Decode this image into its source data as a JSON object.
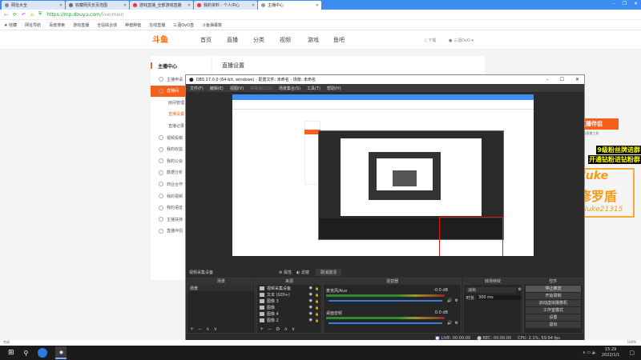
{
  "browser": {
    "tabs": [
      {
        "label": "网址大全",
        "active": false
      },
      {
        "label": "收藏网页长页范围",
        "active": false
      },
      {
        "label": "游戏直播_全部游戏直播",
        "active": false
      },
      {
        "label": "我的资料 - 个人中心",
        "active": false
      },
      {
        "label": "主播中心",
        "active": true
      }
    ],
    "url_host": "https://mp.douyu.com",
    "url_path": "/live/main",
    "bookmarks": [
      "收藏",
      "网址导航",
      "百度搜索",
      "游戏直播",
      "全站综合体",
      "种植种植",
      "在线直播",
      "三酒OvO直",
      "斗鱼弹幕数"
    ],
    "status_left": "完成",
    "status_right": "100%"
  },
  "douyu": {
    "logo": "斗鱼",
    "nav": [
      "首页",
      "直播",
      "分类",
      "视频",
      "游戏",
      "鱼吧"
    ],
    "download": "下载",
    "user": "三酒OvO",
    "sidebar_title": "主播中心",
    "sidebar": [
      {
        "label": "主播申请",
        "type": "item"
      },
      {
        "label": "直播间",
        "type": "active"
      },
      {
        "label": "房间管理",
        "type": "sub"
      },
      {
        "label": "直播设置",
        "type": "sub-orange"
      },
      {
        "label": "直播记录",
        "type": "sub"
      },
      {
        "label": "视频投稿",
        "type": "item"
      },
      {
        "label": "我的收益",
        "type": "item"
      },
      {
        "label": "我的公会",
        "type": "item"
      },
      {
        "label": "数据分析",
        "type": "item"
      },
      {
        "label": "商业合作",
        "type": "item"
      },
      {
        "label": "我的视频",
        "type": "item"
      },
      {
        "label": "我的语音",
        "type": "item"
      },
      {
        "label": "主播扶持",
        "type": "item"
      },
      {
        "label": "直播伴侣",
        "type": "item"
      }
    ],
    "content_title": "直播设置"
  },
  "obs": {
    "title": "OBS 27.0.0 (64-bit, windows) - 配置文件: 未命名 - 场景: 未命名",
    "menu": [
      "文件(F)",
      "编辑(E)",
      "视图(V)",
      "停靠窗口(D)",
      "场景集合(S)",
      "工具(T)",
      "帮助(H)"
    ],
    "source_bar": {
      "selected": "视频采集设备",
      "properties": "属性",
      "filters": "滤镜",
      "deactivate": "取消激活"
    },
    "scenes": {
      "header": "场景",
      "items": [
        "场景"
      ]
    },
    "sources": {
      "header": "来源",
      "items": [
        "视频采集设备",
        "文本 (GDI+)",
        "图像 3",
        "图像",
        "图像 4",
        "图像 2"
      ]
    },
    "mixer": {
      "header": "混音器",
      "channels": [
        {
          "name": "麦克风/Aux",
          "db": "-0.0 dB",
          "level": 0.6
        },
        {
          "name": "桌面音频",
          "db": "0.0 dB",
          "level": 0.0
        }
      ]
    },
    "transitions": {
      "header": "转场特效",
      "type": "淡出",
      "duration_label": "时长",
      "duration": "300 ms"
    },
    "controls": {
      "header": "控件",
      "buttons": [
        "停止推流",
        "开始录制",
        "启动虚拟摄像机",
        "工作室模式",
        "设置",
        "退出"
      ]
    },
    "status": {
      "live": "LIVE: 00:00:00",
      "rec": "REC: 00:00:00",
      "cpu": "CPU: 2.1%, 59.94 fps"
    }
  },
  "promo": {
    "title": "直播伴侣",
    "subtitle": "PC端直播工具",
    "line1": "9级粉丝牌进群",
    "line2": "开通钻粉进钻粉群",
    "brand": "luke",
    "brand2": "修罗盾",
    "contact": "V: luke21315"
  },
  "taskbar": {
    "time": "15:29",
    "date": "2022/1/1"
  }
}
